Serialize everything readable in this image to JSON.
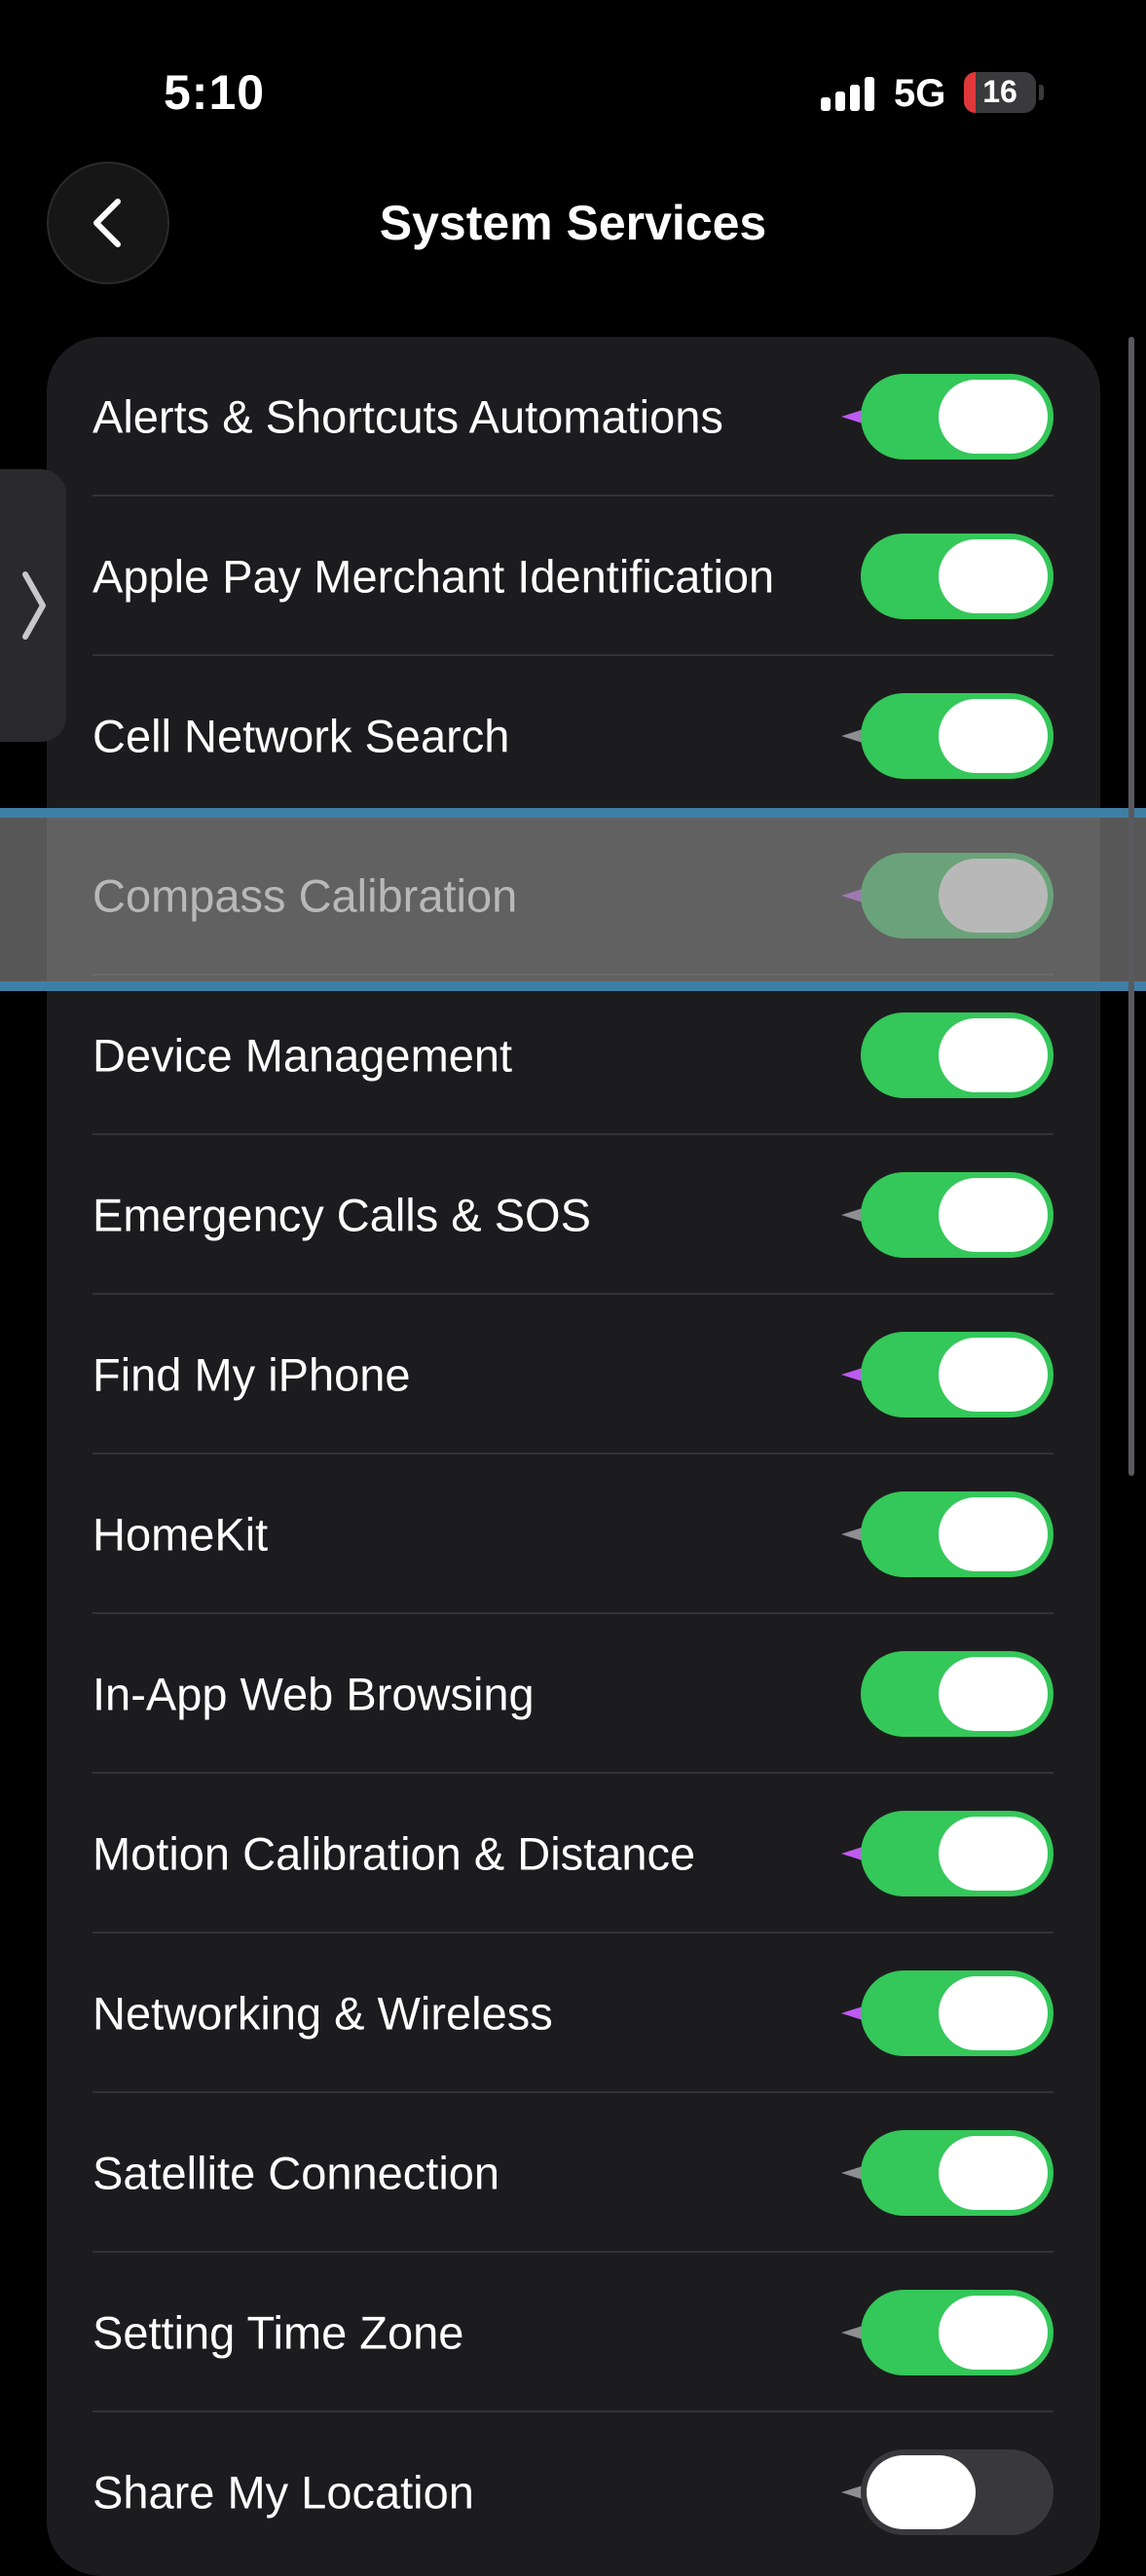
{
  "status_bar": {
    "time": "5:10",
    "network": "5G",
    "battery": "16",
    "battery_level_percent": 16,
    "battery_color": "#e0383a"
  },
  "nav": {
    "title": "System Services",
    "back_icon": "chevron-left-icon"
  },
  "side_tab": {
    "icon": "chevron-right-icon"
  },
  "colors": {
    "toggle_on": "#34c759",
    "toggle_off": "#39393d",
    "indicator_purple": "#bf5af2",
    "indicator_gray": "#8e8e93",
    "highlight_border": "#3f7fa6"
  },
  "services": [
    {
      "label": "Alerts & Shortcuts Automations",
      "enabled": true,
      "indicator": "purple"
    },
    {
      "label": "Apple Pay Merchant Identification",
      "enabled": true,
      "indicator": "none"
    },
    {
      "label": "Cell Network Search",
      "enabled": true,
      "indicator": "gray"
    },
    {
      "label": "Compass Calibration",
      "enabled": true,
      "indicator": "purple",
      "highlighted": true
    },
    {
      "label": "Device Management",
      "enabled": true,
      "indicator": "none"
    },
    {
      "label": "Emergency Calls & SOS",
      "enabled": true,
      "indicator": "gray"
    },
    {
      "label": "Find My iPhone",
      "enabled": true,
      "indicator": "purple"
    },
    {
      "label": "HomeKit",
      "enabled": true,
      "indicator": "gray"
    },
    {
      "label": "In-App Web Browsing",
      "enabled": true,
      "indicator": "none"
    },
    {
      "label": "Motion Calibration & Distance",
      "enabled": true,
      "indicator": "purple"
    },
    {
      "label": "Networking & Wireless",
      "enabled": true,
      "indicator": "purple"
    },
    {
      "label": "Satellite Connection",
      "enabled": true,
      "indicator": "gray"
    },
    {
      "label": "Setting Time Zone",
      "enabled": true,
      "indicator": "gray"
    },
    {
      "label": "Share My Location",
      "enabled": false,
      "indicator": "gray"
    }
  ]
}
